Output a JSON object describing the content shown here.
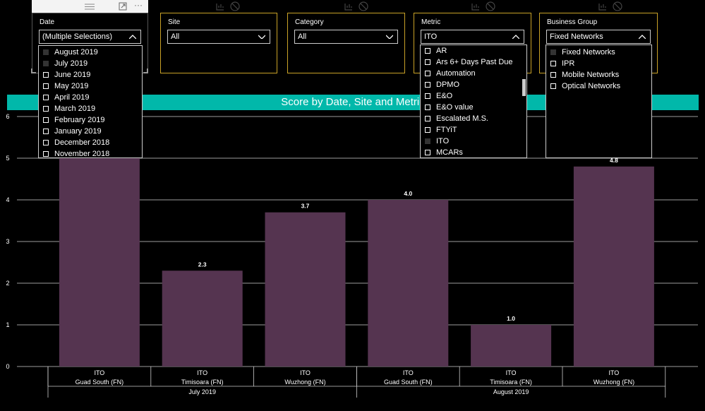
{
  "chart_title": "Score by Date, Site and Metric",
  "slicers": {
    "date": {
      "title": "Date",
      "value": "(Multiple Selections)",
      "options": [
        {
          "label": "August 2019",
          "checked": true
        },
        {
          "label": "July 2019",
          "checked": true
        },
        {
          "label": "June 2019",
          "checked": false
        },
        {
          "label": "May 2019",
          "checked": false
        },
        {
          "label": "April 2019",
          "checked": false
        },
        {
          "label": "March 2019",
          "checked": false
        },
        {
          "label": "February 2019",
          "checked": false
        },
        {
          "label": "January 2019",
          "checked": false
        },
        {
          "label": "December 2018",
          "checked": false
        },
        {
          "label": "November 2018",
          "checked": false
        }
      ]
    },
    "site": {
      "title": "Site",
      "value": "All"
    },
    "category": {
      "title": "Category",
      "value": "All"
    },
    "metric": {
      "title": "Metric",
      "value": "ITO",
      "options": [
        {
          "label": "AR",
          "checked": false
        },
        {
          "label": "Ars 6+ Days Past Due",
          "checked": false
        },
        {
          "label": "Automation",
          "checked": false
        },
        {
          "label": "DPMO",
          "checked": false
        },
        {
          "label": "E&O",
          "checked": false
        },
        {
          "label": "E&O value",
          "checked": false
        },
        {
          "label": "Escalated M.S.",
          "checked": false
        },
        {
          "label": "FTYiT",
          "checked": false
        },
        {
          "label": "ITO",
          "checked": true
        },
        {
          "label": "MCARs",
          "checked": false
        }
      ]
    },
    "business_group": {
      "title": "Business Group",
      "value": "Fixed Networks",
      "options": [
        {
          "label": "Fixed Networks",
          "checked": true
        },
        {
          "label": "IPR",
          "checked": false
        },
        {
          "label": "Mobile Networks",
          "checked": false
        },
        {
          "label": "Optical Networks",
          "checked": false
        }
      ]
    }
  },
  "icons": [
    "more-options-icon",
    "focus-mode-icon",
    "drag-handle-icon",
    "filter-icon",
    "no-filter-icon"
  ],
  "colors": {
    "bar": "#553450",
    "banner": "#01b8aa",
    "slicer_border": "#c9a227",
    "background": "#000000"
  },
  "chart_data": {
    "type": "bar",
    "title": "Score by Date, Site and Metric",
    "ylim": [
      0,
      6
    ],
    "yticks": [
      0,
      1,
      2,
      3,
      4,
      5,
      6
    ],
    "grid": true,
    "bars": [
      {
        "metric": "ITO",
        "site": "Guad South (FN)",
        "date": "July 2019",
        "value": 5.0,
        "label": ""
      },
      {
        "metric": "ITO",
        "site": "Timisoara (FN)",
        "date": "July 2019",
        "value": 2.3,
        "label": "2.3"
      },
      {
        "metric": "ITO",
        "site": "Wuzhong (FN)",
        "date": "July 2019",
        "value": 3.7,
        "label": "3.7"
      },
      {
        "metric": "ITO",
        "site": "Guad South (FN)",
        "date": "August 2019",
        "value": 4.0,
        "label": "4.0"
      },
      {
        "metric": "ITO",
        "site": "Timisoara (FN)",
        "date": "August 2019",
        "value": 1.0,
        "label": "1.0"
      },
      {
        "metric": "ITO",
        "site": "Wuzhong (FN)",
        "date": "August 2019",
        "value": 4.8,
        "label": "4.8"
      }
    ],
    "groups": [
      "July 2019",
      "August 2019"
    ]
  }
}
